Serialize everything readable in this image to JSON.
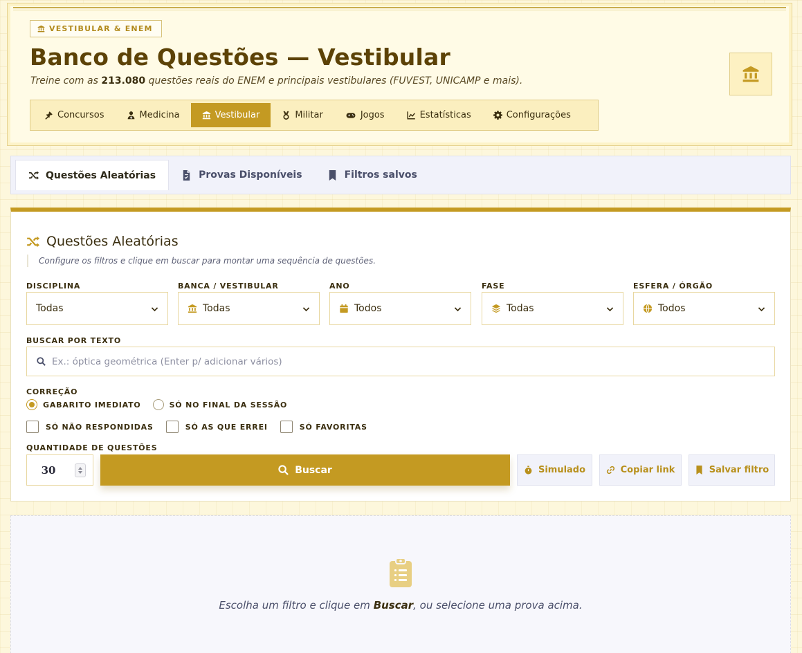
{
  "header": {
    "badge": "VESTIBULAR & ENEM",
    "title": "Banco de Questões — Vestibular",
    "subtitle_prefix": "Treine com as",
    "subtitle_count": "213.080",
    "subtitle_suffix": "questões reais do ENEM e principais vestibulares (FUVEST, UNICAMP e mais).",
    "nav": [
      {
        "label": "Concursos",
        "icon": "gavel-icon",
        "active": false
      },
      {
        "label": "Medicina",
        "icon": "doctor-icon",
        "active": false
      },
      {
        "label": "Vestibular",
        "icon": "institution-icon",
        "active": true
      },
      {
        "label": "Militar",
        "icon": "medal-icon",
        "active": false
      },
      {
        "label": "Jogos",
        "icon": "gamepad-icon",
        "active": false
      },
      {
        "label": "Estatísticas",
        "icon": "chart-line-icon",
        "active": false
      },
      {
        "label": "Configurações",
        "icon": "gear-icon",
        "active": false
      }
    ]
  },
  "tabs": [
    {
      "label": "Questões Aleatórias",
      "icon": "shuffle-icon",
      "active": true
    },
    {
      "label": "Provas Disponíveis",
      "icon": "file-icon",
      "active": false
    },
    {
      "label": "Filtros salvos",
      "icon": "bookmark-icon",
      "active": false
    }
  ],
  "panel": {
    "title": "Questões Aleatórias",
    "hint": "Configure os filtros e clique em buscar para montar uma sequência de questões.",
    "filters": [
      {
        "label": "DISCIPLINA",
        "value": "Todas",
        "icon": ""
      },
      {
        "label": "BANCA / VESTIBULAR",
        "value": "Todas",
        "icon": "institution-icon"
      },
      {
        "label": "ANO",
        "value": "Todos",
        "icon": "calendar-icon"
      },
      {
        "label": "FASE",
        "value": "Todas",
        "icon": "layers-icon"
      },
      {
        "label": "ESFERA / ÓRGÃO",
        "value": "Todos",
        "icon": "globe-icon"
      }
    ],
    "search_label": "BUSCAR POR TEXTO",
    "search_placeholder": "Ex.: óptica geométrica (Enter p/ adicionar vários)",
    "correction_label": "CORREÇÃO",
    "correction_options": [
      {
        "label": "GABARITO IMEDIATO",
        "selected": true
      },
      {
        "label": "SÓ NO FINAL DA SESSÃO",
        "selected": false
      }
    ],
    "checkboxes": [
      "SÓ NÃO RESPONDIDAS",
      "SÓ AS QUE ERREI",
      "SÓ FAVORITAS"
    ],
    "quantity_label": "QUANTIDADE DE QUESTÕES",
    "quantity": "30",
    "search_button": "Buscar",
    "simulado_button": "Simulado",
    "copy_link_button": "Copiar link",
    "save_filter_button": "Salvar filtro"
  },
  "empty_state": {
    "icon": "clipboard-list-icon",
    "text_prefix": "Escolha um filtro e clique em",
    "text_bold": "Buscar",
    "text_suffix": ", ou selecione uma prova acima."
  },
  "colors": {
    "accent": "#c49a22",
    "title": "#5c4206",
    "background": "#fdf7dc"
  }
}
